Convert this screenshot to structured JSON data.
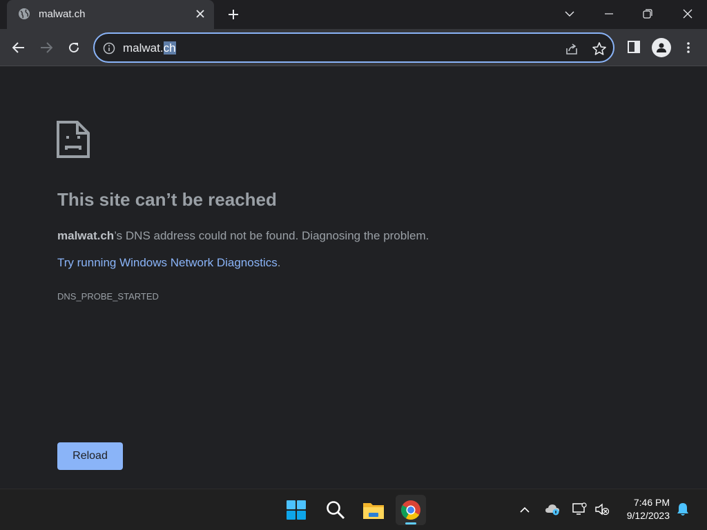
{
  "tab": {
    "title": "malwat.ch",
    "favicon": "globe-icon"
  },
  "omnibox": {
    "url_plain": "malwat.",
    "url_selected": "ch"
  },
  "page": {
    "heading": "This site can’t be reached",
    "desc_host": "malwat.ch",
    "desc_rest": "’s DNS address could not be found. Diagnosing the problem.",
    "diag_link": "Try running Windows Network Diagnostics",
    "diag_period": ".",
    "error_code": "DNS_PROBE_STARTED",
    "reload_label": "Reload"
  },
  "taskbar": {
    "apps": [
      "start-button",
      "search-button",
      "file-explorer",
      "chrome"
    ],
    "time": "7:46 PM",
    "date": "9/12/2023"
  },
  "colors": {
    "accent": "#8ab4f8",
    "background": "#202124",
    "toolbar": "#35363a"
  }
}
